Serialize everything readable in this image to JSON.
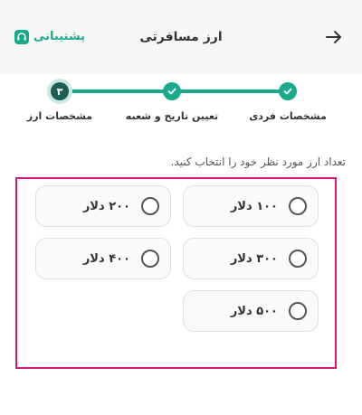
{
  "header": {
    "title": "ارز مسافرتی",
    "support_label": "پشتیبانی",
    "back_icon": "arrow-right-icon",
    "support_icon": "headset-icon",
    "brand_color": "#1ba98c"
  },
  "stepper": {
    "steps": [
      {
        "label": "مشخصات فردی",
        "status": "done"
      },
      {
        "label": "تعیین تاریخ و شعبه",
        "status": "done"
      },
      {
        "label": "مشخصات ارز",
        "status": "current",
        "number": "۳"
      }
    ]
  },
  "instruction": "تعداد ارز مورد نظر خود را انتخاب کنید.",
  "options": [
    {
      "label": "۱۰۰ دلار",
      "selected": false
    },
    {
      "label": "۲۰۰ دلار",
      "selected": false
    },
    {
      "label": "۳۰۰ دلار",
      "selected": false
    },
    {
      "label": "۴۰۰ دلار",
      "selected": false
    },
    {
      "label": "۵۰۰ دلار",
      "selected": false
    }
  ],
  "highlight_color": "#d6187a"
}
